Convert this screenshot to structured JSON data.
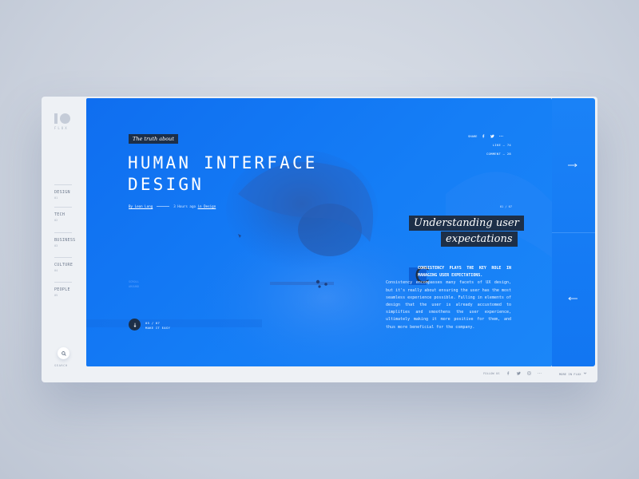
{
  "logo": {
    "mark": "10",
    "text": "FLUX"
  },
  "nav": [
    {
      "label": "DESIGN",
      "num": "01"
    },
    {
      "label": "TECH",
      "num": "02"
    },
    {
      "label": "BUSINESS",
      "num": "03"
    },
    {
      "label": "CULTURE",
      "num": "04"
    },
    {
      "label": "PEOPLE",
      "num": "05"
    }
  ],
  "search": {
    "label": "SEARCH",
    "icon": "search-icon"
  },
  "hero": {
    "tag": "The truth about",
    "title_line1": "HUMAN INTERFACE",
    "title_line2": "DESIGN",
    "author": "By Leon Long",
    "time": "3 Hours ago in",
    "category_link": "in Design",
    "faint_1": "SCROLL",
    "faint_2": "AROUND",
    "scroll_index": "05 / 07",
    "scroll_label": "MAKE IT EASY"
  },
  "share": {
    "label": "SHARE",
    "likes": "LIKE — 74",
    "comments": "COMMENT — 28"
  },
  "article": {
    "page": "01 / 07",
    "callout_1": "Understanding user",
    "callout_2": "expectations",
    "dropcap": "C",
    "lead": "CONSISTENCY PLAYS THE KEY ROLE IN MANAGING USER EXPECTATIONS.",
    "body": "Consistency encompasses many facets of UX design, but it's really about ensuring the user has the most seamless experience possible. Fulling in elements of design that the user is already accustomed to simplifies and smoothens the user experience, ultimately making it more positive for them, and thus more beneficial for the company."
  },
  "footer": {
    "follow": "FOLLOW US",
    "more": "MORE IN FLUX"
  },
  "colors": {
    "hero": "#1275f2",
    "dark": "#1d2f48",
    "frame": "#eef1f5"
  }
}
